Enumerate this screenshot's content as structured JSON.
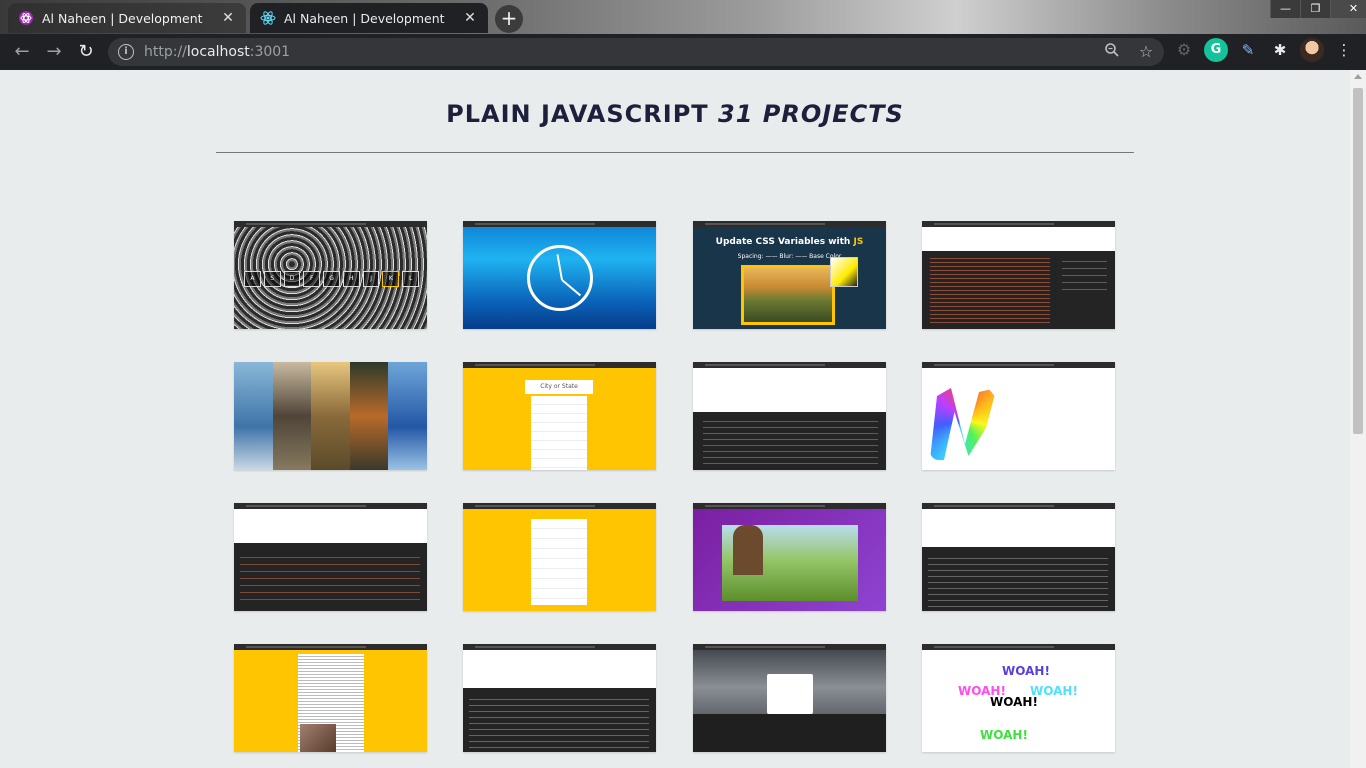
{
  "browser": {
    "tabs": [
      {
        "title": "Al Naheen | Development",
        "active": false
      },
      {
        "title": "Al Naheen | Development",
        "active": true
      }
    ],
    "url": {
      "scheme": "http://",
      "host": "localhost",
      "port": ":3001"
    },
    "window_controls": {
      "minimize": "—",
      "restore": "❐",
      "close": "✕"
    }
  },
  "page": {
    "heading_main": "PLAIN JAVASCRIPT",
    "heading_count": "31 PROJECTS"
  },
  "cards": {
    "drum_keys": [
      "A",
      "S",
      "D",
      "F",
      "G",
      "H",
      "J",
      "K",
      "L"
    ],
    "css_title": "Update CSS Variables with",
    "css_title_js": "JS",
    "css_controls": "Spacing: —— Blur: —— Base Color",
    "search_placeholder": "City or State",
    "woah": [
      "WOAH!",
      "WOAH!",
      "WOAH!",
      "WOAH!",
      "WOAH!"
    ]
  },
  "colors": {
    "accent_yellow": "#ffc600",
    "heading_color": "#1d1f3b",
    "page_bg": "#e9eced",
    "woah_colors": [
      "#5a3fe0",
      "#ff4df0",
      "#4fe0ff",
      "#000000",
      "#3fe03f"
    ]
  }
}
